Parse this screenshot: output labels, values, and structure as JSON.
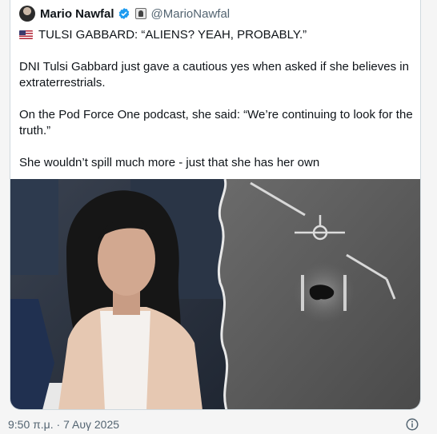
{
  "post": {
    "author_name": "Mario Nawfal",
    "author_handle": "@MarioNawfal",
    "headline": "TULSI GABBARD: “ALIENS? YEAH, PROBABLY.”",
    "paragraph1_line1": "DNI Tulsi Gabbard just gave a cautious yes when asked if she believes in",
    "paragraph1_line2": "extraterrestrials.",
    "paragraph2_line1": "On the Pod Force One podcast, she said: “We’re continuing to look for the",
    "paragraph2_line2": "truth.”",
    "paragraph3": "She wouldn’t spill much more - just that she has her own",
    "timestamp": "9:50 π.μ. · 7 Αυγ 2025"
  },
  "icons": {
    "verified": "verified-badge-icon",
    "flag": "us-flag-icon",
    "info": "info-icon",
    "emoji": "portrait-emoji-icon"
  },
  "colors": {
    "verified": "#1d9bf0",
    "muted_text": "#536471",
    "text": "#0f1419"
  }
}
